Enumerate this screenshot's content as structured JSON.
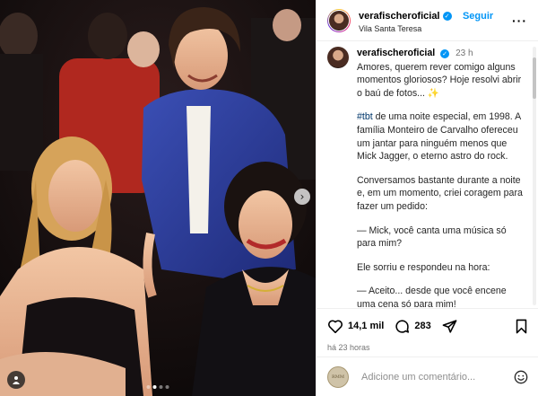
{
  "photo": {
    "alt_icon": "person-tag-icon",
    "next_icon": "chevron-right-icon",
    "dots_count": 4,
    "active_dot": 1
  },
  "header": {
    "username": "verafischeroficial",
    "location": "Vila Santa Teresa",
    "follow_label": "Seguir",
    "more_label": "···"
  },
  "caption": {
    "username": "verafischeroficial",
    "time": "23 h",
    "paragraphs": [
      "Amores, querem rever comigo alguns momentos gloriosos? Hoje resolvi abrir o baú de fotos... ✨",
      "de uma noite especial, em 1998. A família Monteiro de Carvalho ofereceu um jantar para ninguém menos que Mick Jagger, o eterno astro do rock.",
      "Conversamos bastante durante a noite e, em um momento, criei coragem para fazer um pedido:",
      "— Mick, você canta uma música só para mim?",
      "Ele sorriu e respondeu na hora:",
      "— Aceito... desde que você encene uma cena só para mim!"
    ],
    "hashtag": "#tbt"
  },
  "actions": {
    "likes": "14,1 mil",
    "comments": "283",
    "ago": "há 23 horas"
  },
  "comment_bar": {
    "placeholder": "Adicione um comentário...",
    "avatar_text": "RMM"
  },
  "colors": {
    "accent": "#0095f6",
    "hashtag": "#00376b",
    "muted": "#737373"
  }
}
